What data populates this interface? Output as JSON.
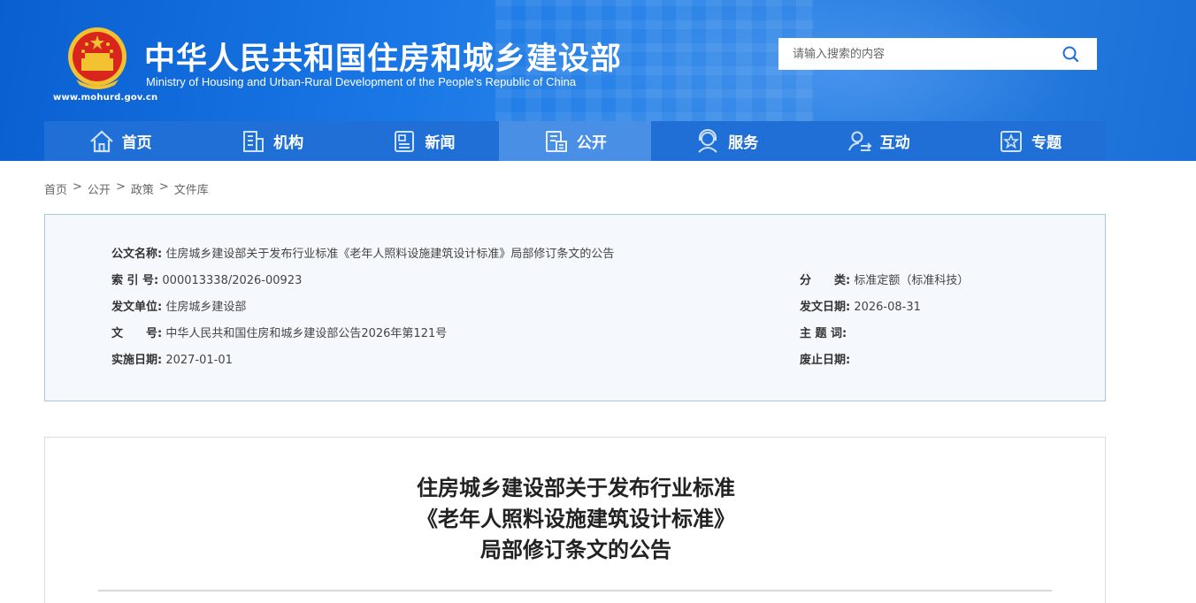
{
  "header": {
    "title_cn": "中华人民共和国住房和城乡建设部",
    "title_en": "Ministry of Housing and Urban-Rural Development of the People’s Republic of China",
    "site_url": "www.mohurd.gov.cn",
    "search_placeholder": "请输入搜索的内容"
  },
  "nav": [
    {
      "label": "首页",
      "icon": "home-icon"
    },
    {
      "label": "机构",
      "icon": "building-icon"
    },
    {
      "label": "新闻",
      "icon": "news-icon"
    },
    {
      "label": "公开",
      "icon": "document-icon",
      "active": true
    },
    {
      "label": "服务",
      "icon": "service-icon"
    },
    {
      "label": "互动",
      "icon": "interaction-icon"
    },
    {
      "label": "专题",
      "icon": "topic-icon"
    }
  ],
  "breadcrumb": [
    "首页",
    "公开",
    "政策",
    "文件库"
  ],
  "info": {
    "doc_name_label": "公文名称:",
    "doc_name": "住房城乡建设部关于发布行业标准《老年人照料设施建筑设计标准》局部修订条文的公告",
    "index_label": "索 引 号:",
    "index": "000013338/2026-00923",
    "category_label": "分　　类:",
    "category": "标准定额（标准科技）",
    "issuer_label": "发文单位:",
    "issuer": "住房城乡建设部",
    "issue_date_label": "发文日期:",
    "issue_date": "2026-08-31",
    "doc_no_label": "文　　号:",
    "doc_no": "中华人民共和国住房和城乡建设部公告2026年第121号",
    "subject_label": "主 题 词:",
    "subject": "",
    "effective_label": "实施日期:",
    "effective": "2027-01-01",
    "expiry_label": "废止日期:",
    "expiry": ""
  },
  "article": {
    "title_line1": "住房城乡建设部关于发布行业标准",
    "title_line2": "《老年人照料设施建筑设计标准》",
    "title_line3": "局部修订条文的公告"
  },
  "colors": {
    "header_blue": "#1a78e6",
    "nav_blue": "#1f6fd6",
    "nav_active": "#4a8fe6",
    "info_bg": "#f5f9fd",
    "info_border": "#a9c9e3"
  }
}
